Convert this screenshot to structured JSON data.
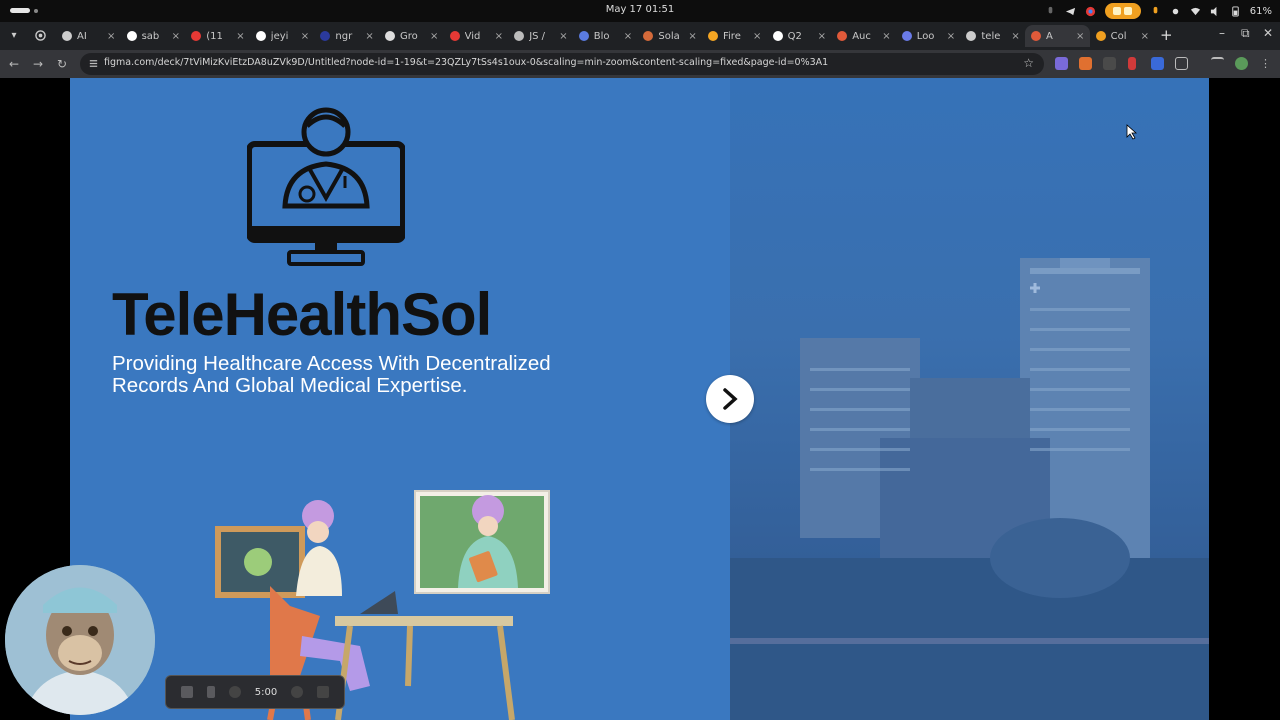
{
  "os": {
    "clock": "May 17  01:51",
    "battery": "61%"
  },
  "browser": {
    "tabs": [
      {
        "label": "AI",
        "favicon": "ai-icon",
        "color": "#cccccc"
      },
      {
        "label": "sab",
        "favicon": "github-icon",
        "color": "#ffffff"
      },
      {
        "label": "(11",
        "favicon": "youtube-icon",
        "color": "#e53935"
      },
      {
        "label": "jeyi",
        "favicon": "github-icon",
        "color": "#ffffff"
      },
      {
        "label": "ngr",
        "favicon": "ngrok-icon",
        "color": "#2b3a9c"
      },
      {
        "label": "Gro",
        "favicon": "x-icon",
        "color": "#dddddd"
      },
      {
        "label": "Vid",
        "favicon": "youtube-icon",
        "color": "#e53935"
      },
      {
        "label": "JS /",
        "favicon": "globe-icon",
        "color": "#bbbbbb"
      },
      {
        "label": "Blo",
        "favicon": "blog-icon",
        "color": "#5a7be0"
      },
      {
        "label": "Sola",
        "favicon": "solana-icon",
        "color": "#d46a3a"
      },
      {
        "label": "Fire",
        "favicon": "firebase-icon",
        "color": "#f5a623"
      },
      {
        "label": "Q2",
        "favicon": "github-icon",
        "color": "#ffffff"
      },
      {
        "label": "Auc",
        "favicon": "figma-icon",
        "color": "#e05a3a"
      },
      {
        "label": "Loo",
        "favicon": "gear-icon",
        "color": "#6a7be8"
      },
      {
        "label": "tele",
        "favicon": "tele-icon",
        "color": "#cccccc"
      },
      {
        "label": "A",
        "favicon": "figma-icon",
        "color": "#e05a3a"
      },
      {
        "label": "Col",
        "favicon": "colab-icon",
        "color": "#f0a020"
      }
    ],
    "url": "figma.com/deck/7tViMizKviEtzDA8uZVk9D/Untitled?node-id=1-19&t=23QZLy7tSs4s1oux-0&scaling=min-zoom&content-scaling=fixed&page-id=0%3A1"
  },
  "slide": {
    "title": "TeleHealthSol",
    "subtitle_line1": "Providing Healthcare Access With Decentralized",
    "subtitle_line2": "Records And Global Medical Expertise.",
    "bg_color": "#3a78c0",
    "title_color": "#111111",
    "subtitle_color": "#ffffff"
  },
  "recorder": {
    "time": "5:00"
  }
}
